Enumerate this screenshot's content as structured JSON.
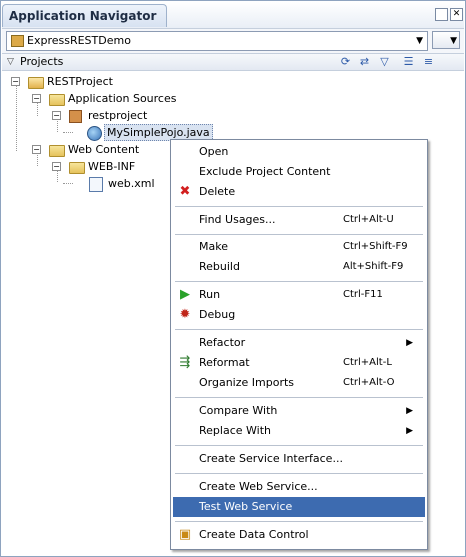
{
  "window": {
    "title": "Application Navigator"
  },
  "selector": {
    "project": "ExpressRESTDemo"
  },
  "projects_header": {
    "label": "Projects"
  },
  "tree": {
    "root": "RESTProject",
    "app_sources": "Application Sources",
    "package": "restproject",
    "java_file": "MySimplePojo.java",
    "web_content": "Web Content",
    "web_inf": "WEB-INF",
    "web_xml": "web.xml"
  },
  "context_menu": {
    "open": "Open",
    "exclude": "Exclude Project Content",
    "delete": "Delete",
    "find_usages": "Find Usages...",
    "find_usages_sc": "Ctrl+Alt-U",
    "make": "Make",
    "make_sc": "Ctrl+Shift-F9",
    "rebuild": "Rebuild",
    "rebuild_sc": "Alt+Shift-F9",
    "run": "Run",
    "run_sc": "Ctrl-F11",
    "debug": "Debug",
    "refactor": "Refactor",
    "reformat": "Reformat",
    "reformat_sc": "Ctrl+Alt-L",
    "organize_imports": "Organize Imports",
    "organize_imports_sc": "Ctrl+Alt-O",
    "compare_with": "Compare With",
    "replace_with": "Replace With",
    "create_service_interface": "Create Service Interface...",
    "create_web_service": "Create Web Service...",
    "test_web_service": "Test Web Service",
    "create_data_control": "Create Data Control"
  },
  "colors": {
    "highlight": "#3d6bb0",
    "accent": "#1f2d44"
  }
}
